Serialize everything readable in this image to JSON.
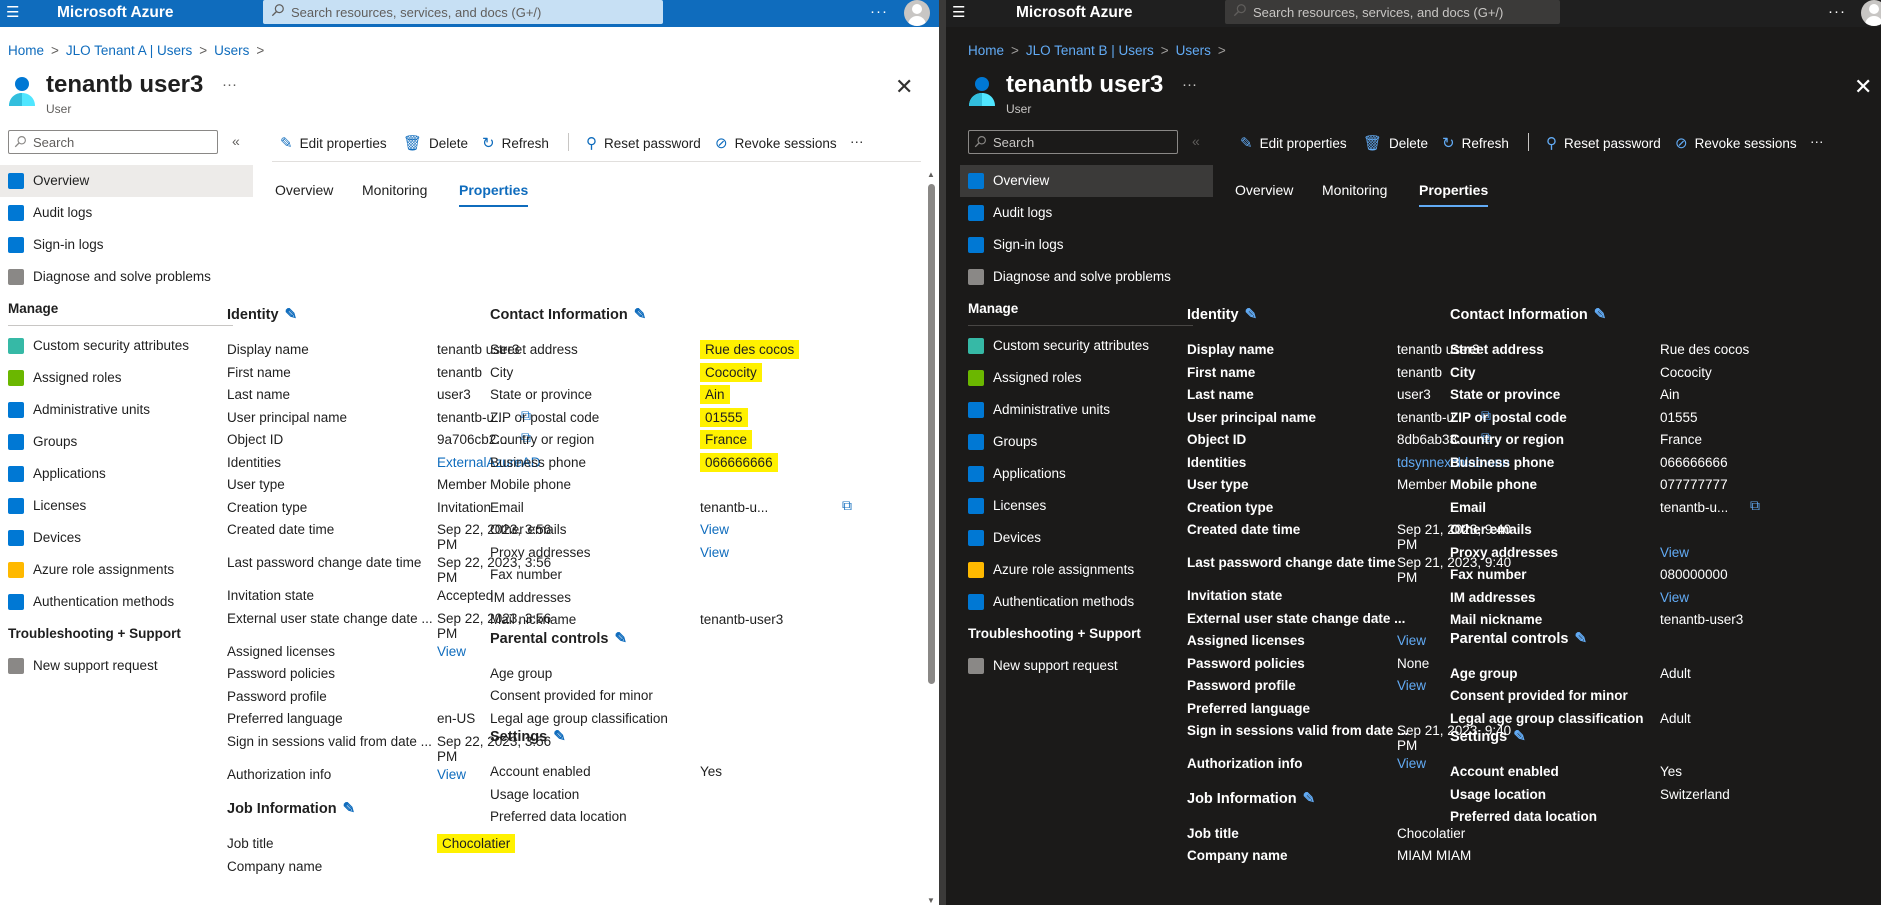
{
  "colors": {
    "accent_light": "#0f6cbd",
    "accent_dark": "#62abf5",
    "highlight": "#fff100",
    "dark_bg": "#1b1a19"
  },
  "panes": [
    {
      "brand": "Microsoft Azure",
      "search_placeholder": "Search resources, services, and docs (G+/)",
      "topbar_more": "···",
      "breadcrumb": [
        "Home",
        "JLO Tenant A | Users",
        "Users"
      ],
      "breadcrumb_sep": ">",
      "user_name": "tenantb user3",
      "user_sub": "User",
      "user_more": "···",
      "close": "✕",
      "side_search": "Search",
      "collapse": "«",
      "nav_top": [
        {
          "label": "Overview",
          "icon": "user-icon"
        },
        {
          "label": "Audit logs",
          "icon": "audit-log-icon"
        },
        {
          "label": "Sign-in logs",
          "icon": "sign-in-icon"
        },
        {
          "label": "Diagnose and solve problems",
          "icon": "wrench-icon"
        }
      ],
      "nav_manage_head": "Manage",
      "nav_manage": [
        {
          "label": "Custom security attributes",
          "icon": "attributes-icon"
        },
        {
          "label": "Assigned roles",
          "icon": "roles-icon"
        },
        {
          "label": "Administrative units",
          "icon": "admin-units-icon"
        },
        {
          "label": "Groups",
          "icon": "groups-icon"
        },
        {
          "label": "Applications",
          "icon": "applications-icon"
        },
        {
          "label": "Licenses",
          "icon": "licenses-icon"
        },
        {
          "label": "Devices",
          "icon": "devices-icon"
        },
        {
          "label": "Azure role assignments",
          "icon": "key-icon"
        },
        {
          "label": "Authentication methods",
          "icon": "shield-icon"
        }
      ],
      "nav_support_head": "Troubleshooting + Support",
      "nav_support": [
        {
          "label": "New support request",
          "icon": "support-icon"
        }
      ],
      "toolbar": {
        "edit": "Edit properties",
        "delete": "Delete",
        "refresh": "Refresh",
        "reset": "Reset password",
        "revoke": "Revoke sessions",
        "more": "···"
      },
      "tabs": [
        "Overview",
        "Monitoring",
        "Properties"
      ],
      "identity": {
        "title": "Identity",
        "rows": [
          {
            "label": "Display name",
            "value": "tenantb user3"
          },
          {
            "label": "First name",
            "value": "tenantb"
          },
          {
            "label": "Last name",
            "value": "user3"
          },
          {
            "label": "User principal name",
            "value": "tenantb-u...",
            "copy": true
          },
          {
            "label": "Object ID",
            "value": "9a706cb2...",
            "copy": true
          },
          {
            "label": "Identities",
            "value": "ExternalAzureAD",
            "link": true
          },
          {
            "label": "User type",
            "value": "Member"
          },
          {
            "label": "Creation type",
            "value": "Invitation"
          },
          {
            "label": "Created date time",
            "value": "Sep 22, 2023, 3:56",
            "value2": "PM"
          },
          {
            "label": "Last password change date time",
            "value": "Sep 22, 2023, 3:56",
            "value2": "PM"
          },
          {
            "label": "Invitation state",
            "value": "Accepted"
          },
          {
            "label": "External user state change date ...",
            "value": "Sep 22, 2023, 3:56",
            "value2": "PM"
          },
          {
            "label": "Assigned licenses",
            "value": "View",
            "link": true
          },
          {
            "label": "Password policies",
            "value": ""
          },
          {
            "label": "Password profile",
            "value": ""
          },
          {
            "label": "Preferred language",
            "value": "en-US"
          },
          {
            "label": "Sign in sessions valid from date ...",
            "value": "Sep 22, 2023, 3:56",
            "value2": "PM"
          },
          {
            "label": "Authorization info",
            "value": "View",
            "link": true
          }
        ]
      },
      "job": {
        "title": "Job Information",
        "rows": [
          {
            "label": "Job title",
            "value": "Chocolatier",
            "highlight": true
          },
          {
            "label": "Company name",
            "value": ""
          }
        ]
      },
      "contact": {
        "title": "Contact Information",
        "rows": [
          {
            "label": "Street address",
            "value": "Rue des cocos",
            "highlight": true
          },
          {
            "label": "City",
            "value": "Cococity",
            "highlight": true
          },
          {
            "label": "State or province",
            "value": "Ain",
            "highlight": true
          },
          {
            "label": "ZIP or postal code",
            "value": "01555",
            "highlight": true
          },
          {
            "label": "Country or region",
            "value": "France",
            "highlight": true
          },
          {
            "label": "Business phone",
            "value": "066666666",
            "highlight": true
          },
          {
            "label": "Mobile phone",
            "value": ""
          },
          {
            "label": "Email",
            "value": "tenantb-u...",
            "copy": true
          },
          {
            "label": "Other emails",
            "value": "View",
            "link": true
          },
          {
            "label": "Proxy addresses",
            "value": "View",
            "link": true
          },
          {
            "label": "Fax number",
            "value": ""
          },
          {
            "label": "IM addresses",
            "value": ""
          },
          {
            "label": "Mail nickname",
            "value": "tenantb-user3"
          }
        ]
      },
      "parental": {
        "title": "Parental controls",
        "rows": [
          {
            "label": "Age group",
            "value": ""
          },
          {
            "label": "Consent provided for minor",
            "value": ""
          },
          {
            "label": "Legal age group classification",
            "value": ""
          }
        ]
      },
      "settings": {
        "title": "Settings",
        "rows": [
          {
            "label": "Account enabled",
            "value": "Yes"
          },
          {
            "label": "Usage location",
            "value": ""
          },
          {
            "label": "Preferred data location",
            "value": ""
          }
        ]
      }
    },
    {
      "brand": "Microsoft Azure",
      "search_placeholder": "Search resources, services, and docs (G+/)",
      "topbar_more": "···",
      "breadcrumb": [
        "Home",
        "JLO Tenant B | Users",
        "Users"
      ],
      "breadcrumb_sep": ">",
      "user_name": "tenantb user3",
      "user_sub": "User",
      "user_more": "···",
      "close": "✕",
      "side_search": "Search",
      "collapse": "«",
      "nav_top": [
        {
          "label": "Overview",
          "icon": "user-icon"
        },
        {
          "label": "Audit logs",
          "icon": "audit-log-icon"
        },
        {
          "label": "Sign-in logs",
          "icon": "sign-in-icon"
        },
        {
          "label": "Diagnose and solve problems",
          "icon": "wrench-icon"
        }
      ],
      "nav_manage_head": "Manage",
      "nav_manage": [
        {
          "label": "Custom security attributes",
          "icon": "attributes-icon"
        },
        {
          "label": "Assigned roles",
          "icon": "roles-icon"
        },
        {
          "label": "Administrative units",
          "icon": "admin-units-icon"
        },
        {
          "label": "Groups",
          "icon": "groups-icon"
        },
        {
          "label": "Applications",
          "icon": "applications-icon"
        },
        {
          "label": "Licenses",
          "icon": "licenses-icon"
        },
        {
          "label": "Devices",
          "icon": "devices-icon"
        },
        {
          "label": "Azure role assignments",
          "icon": "key-icon"
        },
        {
          "label": "Authentication methods",
          "icon": "shield-icon"
        }
      ],
      "nav_support_head": "Troubleshooting + Support",
      "nav_support": [
        {
          "label": "New support request",
          "icon": "support-icon"
        }
      ],
      "toolbar": {
        "edit": "Edit properties",
        "delete": "Delete",
        "refresh": "Refresh",
        "reset": "Reset password",
        "revoke": "Revoke sessions",
        "more": "···"
      },
      "tabs": [
        "Overview",
        "Monitoring",
        "Properties"
      ],
      "identity": {
        "title": "Identity",
        "rows": [
          {
            "label": "Display name",
            "value": "tenantb user3"
          },
          {
            "label": "First name",
            "value": "tenantb"
          },
          {
            "label": "Last name",
            "value": "user3"
          },
          {
            "label": "User principal name",
            "value": "tenantb-u...",
            "copy": true
          },
          {
            "label": "Object ID",
            "value": "8db6ab33...",
            "copy": true
          },
          {
            "label": "Identities",
            "value": "tdsynnexchlab.onn",
            "link": true
          },
          {
            "label": "User type",
            "value": "Member"
          },
          {
            "label": "Creation type",
            "value": ""
          },
          {
            "label": "Created date time",
            "value": "Sep 21, 2023, 9:40",
            "value2": "PM"
          },
          {
            "label": "Last password change date time",
            "value": "Sep 21, 2023, 9:40",
            "value2": "PM"
          },
          {
            "label": "Invitation state",
            "value": ""
          },
          {
            "label": "External user state change date ...",
            "value": ""
          },
          {
            "label": "Assigned licenses",
            "value": "View",
            "link": true
          },
          {
            "label": "Password policies",
            "value": "None"
          },
          {
            "label": "Password profile",
            "value": "View",
            "link": true
          },
          {
            "label": "Preferred language",
            "value": ""
          },
          {
            "label": "Sign in sessions valid from date ...",
            "value": "Sep 21, 2023, 9:40",
            "value2": "PM"
          },
          {
            "label": "Authorization info",
            "value": "View",
            "link": true
          }
        ]
      },
      "job": {
        "title": "Job Information",
        "rows": [
          {
            "label": "Job title",
            "value": "Chocolatier"
          },
          {
            "label": "Company name",
            "value": "MIAM MIAM"
          }
        ]
      },
      "contact": {
        "title": "Contact Information",
        "rows": [
          {
            "label": "Street address",
            "value": "Rue des cocos"
          },
          {
            "label": "City",
            "value": "Cococity"
          },
          {
            "label": "State or province",
            "value": "Ain"
          },
          {
            "label": "ZIP or postal code",
            "value": "01555"
          },
          {
            "label": "Country or region",
            "value": "France"
          },
          {
            "label": "Business phone",
            "value": "066666666"
          },
          {
            "label": "Mobile phone",
            "value": "077777777"
          },
          {
            "label": "Email",
            "value": "tenantb-u...",
            "copy": true
          },
          {
            "label": "Other emails",
            "value": ""
          },
          {
            "label": "Proxy addresses",
            "value": "View",
            "link": true
          },
          {
            "label": "Fax number",
            "value": "080000000"
          },
          {
            "label": "IM addresses",
            "value": "View",
            "link": true
          },
          {
            "label": "Mail nickname",
            "value": "tenantb-user3"
          }
        ]
      },
      "parental": {
        "title": "Parental controls",
        "rows": [
          {
            "label": "Age group",
            "value": "Adult"
          },
          {
            "label": "Consent provided for minor",
            "value": ""
          },
          {
            "label": "Legal age group classification",
            "value": "Adult"
          }
        ]
      },
      "settings": {
        "title": "Settings",
        "rows": [
          {
            "label": "Account enabled",
            "value": "Yes"
          },
          {
            "label": "Usage location",
            "value": "Switzerland"
          },
          {
            "label": "Preferred data location",
            "value": ""
          }
        ]
      }
    }
  ]
}
